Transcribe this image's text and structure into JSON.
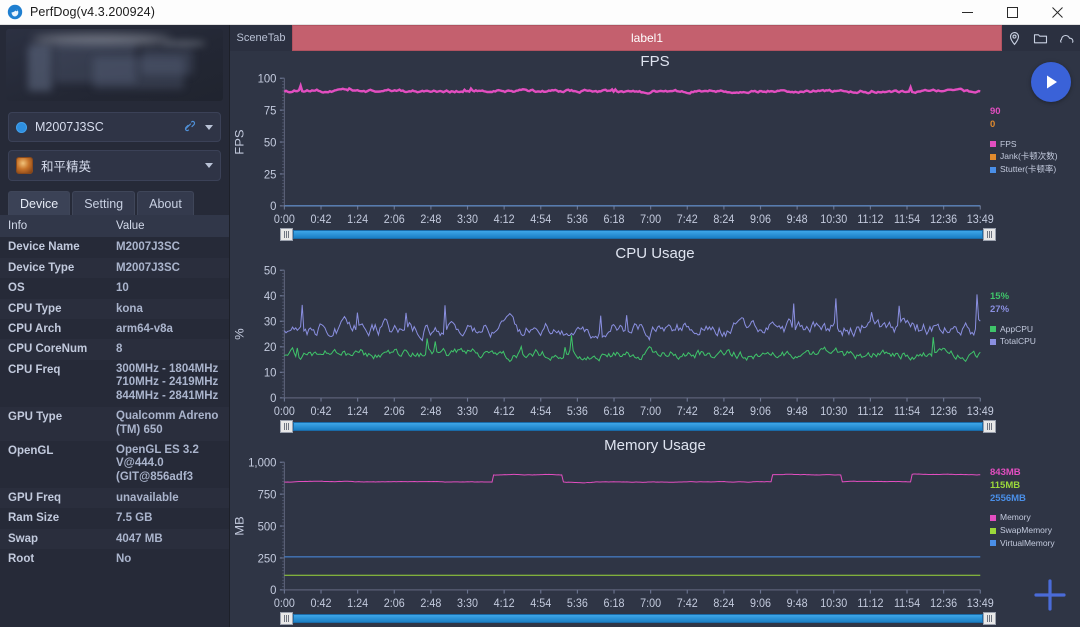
{
  "window": {
    "title": "PerfDog(v4.3.200924)",
    "logo_icon": "perfdog-logo-icon",
    "minimize_icon": "minimize-icon",
    "maximize_icon": "maximize-icon",
    "close_icon": "close-icon"
  },
  "sidebar": {
    "device_selector": {
      "label": "M2007J3SC",
      "status_icon": "usb-connected-icon",
      "caret_icon": "chevron-down-icon"
    },
    "app_selector": {
      "label": "和平精英",
      "app_icon": "game-app-icon",
      "caret_icon": "chevron-down-icon"
    },
    "tabs": [
      {
        "label": "Device",
        "active": true
      },
      {
        "label": "Setting",
        "active": false
      },
      {
        "label": "About",
        "active": false
      }
    ],
    "table": {
      "headers": {
        "key": "Info",
        "value": "Value"
      },
      "rows": [
        {
          "key": "Device Name",
          "value": "M2007J3SC"
        },
        {
          "key": "Device Type",
          "value": "M2007J3SC"
        },
        {
          "key": "OS",
          "value": "10"
        },
        {
          "key": "CPU Type",
          "value": "kona"
        },
        {
          "key": "CPU Arch",
          "value": "arm64-v8a"
        },
        {
          "key": "CPU CoreNum",
          "value": "8"
        },
        {
          "key": "CPU Freq",
          "value": "300MHz - 1804MHz\n710MHz - 2419MHz\n844MHz - 2841MHz"
        },
        {
          "key": "GPU Type",
          "value": "Qualcomm Adreno\n(TM) 650"
        },
        {
          "key": "OpenGL",
          "value": "OpenGL ES 3.2\nV@444.0\n(GIT@856adf3"
        },
        {
          "key": "GPU Freq",
          "value": "unavailable"
        },
        {
          "key": "Ram Size",
          "value": "7.5 GB"
        },
        {
          "key": "Swap",
          "value": "4047 MB"
        },
        {
          "key": "Root",
          "value": "No"
        }
      ]
    }
  },
  "scenebar": {
    "scene_tab_label": "SceneTab",
    "label_text": "label1",
    "icons": [
      {
        "name": "location-pin-icon"
      },
      {
        "name": "folder-icon"
      },
      {
        "name": "cloud-icon"
      }
    ]
  },
  "controls": {
    "play_icon": "play-icon",
    "add_icon": "plus-icon",
    "slider_grip_icon": "slider-grip-icon"
  },
  "colors": {
    "fps": "#e24ec0",
    "jank": "#e08a2e",
    "stutter": "#4a8fe8",
    "app_cpu": "#3fc46a",
    "total_cpu": "#8a8fe0",
    "memory": "#e24ec0",
    "swap_memory": "#9bd83a",
    "virtual_memory": "#4a8fe8",
    "label_bar": "#c4606e",
    "play_button": "#3a62d8"
  },
  "chart_data": [
    {
      "type": "line",
      "title": "FPS",
      "ylabel": "FPS",
      "xlabel": "",
      "ylim": [
        0,
        100
      ],
      "yticks": [
        0,
        25,
        50,
        75,
        100
      ],
      "xticks": [
        "0:00",
        "0:42",
        "1:24",
        "2:06",
        "2:48",
        "3:30",
        "4:12",
        "4:54",
        "5:36",
        "6:18",
        "7:00",
        "7:42",
        "8:24",
        "9:06",
        "9:48",
        "10:30",
        "11:12",
        "11:54",
        "12:36",
        "13:49"
      ],
      "grid": false,
      "legend_position": "right",
      "current_values": [
        {
          "label": "90",
          "color": "#e24ec0"
        },
        {
          "label": "0",
          "color": "#e08a2e"
        }
      ],
      "series": [
        {
          "name": "FPS",
          "color": "#e24ec0",
          "mean": 90,
          "noise": 1.2
        },
        {
          "name": "Jank(卡顿次数)",
          "color": "#e08a2e",
          "mean": 0,
          "noise": 0
        },
        {
          "name": "Stutter(卡顿率)",
          "color": "#4a8fe8",
          "mean": 0,
          "noise": 0
        }
      ]
    },
    {
      "type": "line",
      "title": "CPU Usage",
      "ylabel": "%",
      "xlabel": "",
      "ylim": [
        0,
        50
      ],
      "yticks": [
        0,
        10,
        20,
        30,
        40,
        50
      ],
      "xticks": [
        "0:00",
        "0:42",
        "1:24",
        "2:06",
        "2:48",
        "3:30",
        "4:12",
        "4:54",
        "5:36",
        "6:18",
        "7:00",
        "7:42",
        "8:24",
        "9:06",
        "9:48",
        "10:30",
        "11:12",
        "11:54",
        "12:36",
        "13:49"
      ],
      "grid": false,
      "legend_position": "right",
      "current_values": [
        {
          "label": "15%",
          "color": "#3fc46a"
        },
        {
          "label": "27%",
          "color": "#8a8fe0"
        }
      ],
      "series": [
        {
          "name": "AppCPU",
          "color": "#3fc46a",
          "mean": 17,
          "noise": 2.2
        },
        {
          "name": "TotalCPU",
          "color": "#8a8fe0",
          "mean": 27,
          "noise": 3.4
        }
      ]
    },
    {
      "type": "line",
      "title": "Memory Usage",
      "ylabel": "MB",
      "xlabel": "",
      "ylim": [
        0,
        1000
      ],
      "yticks": [
        0,
        250,
        500,
        750,
        1000
      ],
      "ytick_labels": [
        "0",
        "250",
        "500",
        "750",
        "1,000"
      ],
      "xticks": [
        "0:00",
        "0:42",
        "1:24",
        "2:06",
        "2:48",
        "3:30",
        "4:12",
        "4:54",
        "5:36",
        "6:18",
        "7:00",
        "7:42",
        "8:24",
        "9:06",
        "9:48",
        "10:30",
        "11:12",
        "11:54",
        "12:36",
        "13:49"
      ],
      "grid": false,
      "legend_position": "right",
      "current_values": [
        {
          "label": "843MB",
          "color": "#e24ec0"
        },
        {
          "label": "115MB",
          "color": "#9bd83a"
        },
        {
          "label": "2556MB",
          "color": "#4a8fe8"
        }
      ],
      "series": [
        {
          "name": "Memory",
          "color": "#e24ec0",
          "mean": 845,
          "noise": 8
        },
        {
          "name": "SwapMemory",
          "color": "#9bd83a",
          "mean": 115,
          "noise": 0
        },
        {
          "name": "VirtualMemory",
          "color": "#4a8fe8",
          "mean": 258,
          "noise": 0
        }
      ]
    }
  ]
}
